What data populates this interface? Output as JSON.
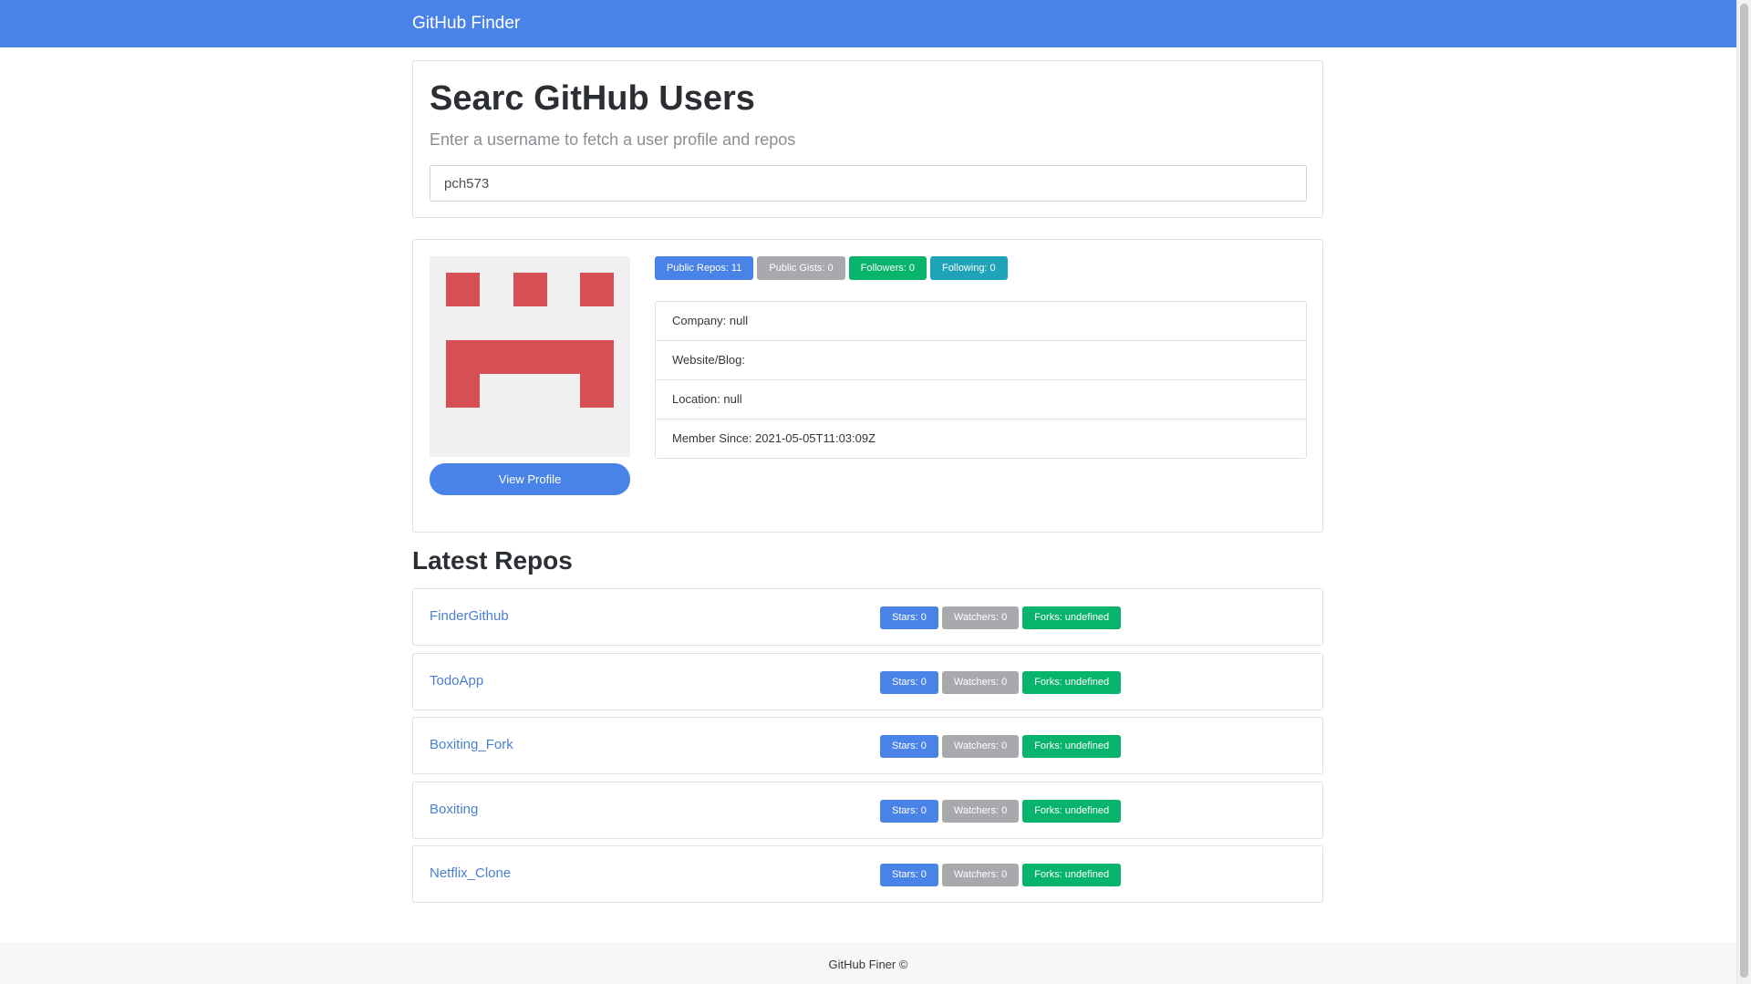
{
  "navbar": {
    "brand": "GitHub Finder"
  },
  "search": {
    "title": "Searc GitHub Users",
    "subtitle": "Enter a username to fetch a user profile and repos",
    "value": "pch573"
  },
  "profile": {
    "avatar_color": "#d64f54",
    "view_profile_label": "View Profile",
    "badges": {
      "public_repos": "Public Repos: 11",
      "public_gists": "Public Gists: 0",
      "followers": "Followers: 0",
      "following": "Following: 0"
    },
    "info": {
      "company": "Company: null",
      "website": "Website/Blog:",
      "location": "Location: null",
      "member_since": "Member Since: 2021-05-05T11:03:09Z"
    }
  },
  "repos": {
    "heading": "Latest Repos",
    "items": [
      {
        "name": "FinderGithub",
        "stars": "Stars: 0",
        "watchers": "Watchers: 0",
        "forks": "Forks: undefined"
      },
      {
        "name": "TodoApp",
        "stars": "Stars: 0",
        "watchers": "Watchers: 0",
        "forks": "Forks: undefined"
      },
      {
        "name": "Boxiting_Fork",
        "stars": "Stars: 0",
        "watchers": "Watchers: 0",
        "forks": "Forks: undefined"
      },
      {
        "name": "Boxiting",
        "stars": "Stars: 0",
        "watchers": "Watchers: 0",
        "forks": "Forks: undefined"
      },
      {
        "name": "Netflix_Clone",
        "stars": "Stars: 0",
        "watchers": "Watchers: 0",
        "forks": "Forks: undefined"
      }
    ]
  },
  "footer": {
    "text": "GitHub Finer ©"
  },
  "colors": {
    "primary": "#4a83e8",
    "secondary": "#a7a9ac",
    "success": "#07b46b",
    "info": "#1ea3b8"
  }
}
